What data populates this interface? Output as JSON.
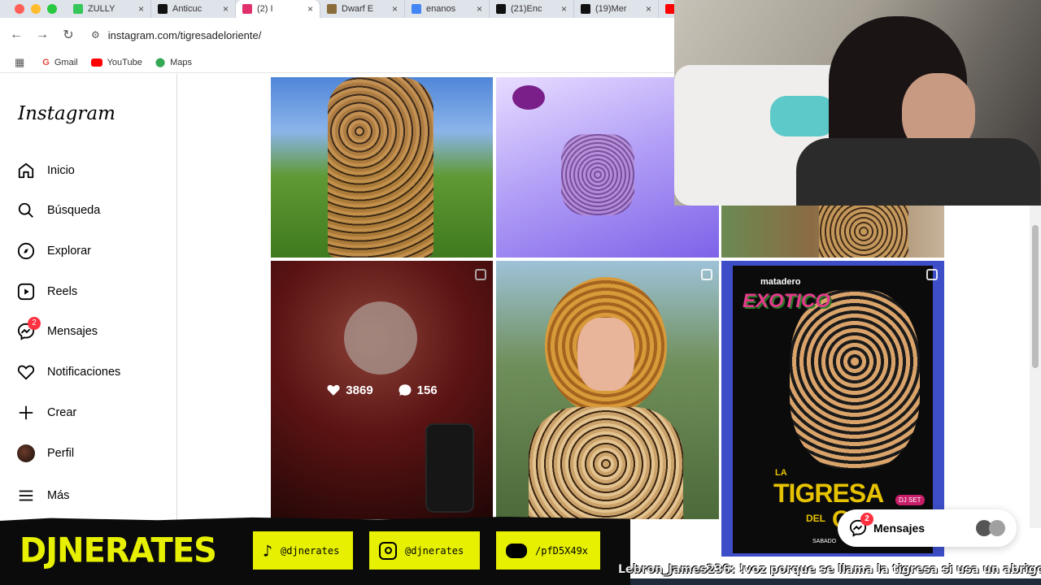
{
  "browser": {
    "tabs": [
      {
        "title": "ZULLY",
        "color": "#35c759",
        "active": false
      },
      {
        "title": "Anticuc",
        "color": "#111111",
        "active": false
      },
      {
        "title": "(2) I",
        "color": "#e1306c",
        "active": true
      },
      {
        "title": "Dwarf E",
        "color": "#8a6d3b",
        "active": false
      },
      {
        "title": "enanos",
        "color": "#4285f4",
        "active": false
      },
      {
        "title": "(21)Enc",
        "color": "#111111",
        "active": false
      },
      {
        "title": "(19)Mer",
        "color": "#111111",
        "active": false
      },
      {
        "title": "",
        "color": "#ff0000",
        "active": false
      }
    ],
    "url": "instagram.com/tigresadeloriente/",
    "bookmarks": [
      {
        "label": "Gmail",
        "icon": "gmail-icon",
        "color": "#ea4335"
      },
      {
        "label": "YouTube",
        "icon": "youtube-icon",
        "color": "#ff0000"
      },
      {
        "label": "Maps",
        "icon": "maps-icon",
        "color": "#34a853"
      }
    ]
  },
  "instagram": {
    "logo": "Instagram",
    "nav": [
      {
        "label": "Inicio",
        "icon": "home-icon"
      },
      {
        "label": "Búsqueda",
        "icon": "search-icon"
      },
      {
        "label": "Explorar",
        "icon": "compass-icon"
      },
      {
        "label": "Reels",
        "icon": "reels-icon"
      },
      {
        "label": "Mensajes",
        "icon": "messenger-icon",
        "badge": "2"
      },
      {
        "label": "Notificaciones",
        "icon": "heart-icon"
      },
      {
        "label": "Crear",
        "icon": "plus-icon"
      },
      {
        "label": "Perfil",
        "icon": "avatar-icon"
      },
      {
        "label": "Más",
        "icon": "menu-icon"
      }
    ],
    "hover_stats": {
      "likes": "3869",
      "comments": "156"
    },
    "poster": {
      "brand": "matadero",
      "title": "EXOTICO",
      "headline": "TIGRESA",
      "small": "DEL",
      "partial": "O",
      "tag": "DJ SET",
      "day": "SABADO",
      "prefix": "LA"
    },
    "messages_pill": {
      "label": "Mensajes",
      "badge": "2"
    }
  },
  "stream": {
    "brand": "DJNERATES",
    "socials": [
      {
        "handle": "@djnerates",
        "icon": "tiktok-icon"
      },
      {
        "handle": "@djnerates",
        "icon": "instagram-icon"
      },
      {
        "handle": "/pfD5X49x",
        "icon": "discord-icon"
      }
    ],
    "chat": {
      "user": "Lebron_James236",
      "message": ": !voz porque se llama la tigresa si usa un abrigo de lo"
    }
  },
  "colors": {
    "accent": "#e6f000",
    "badge": "#ff3040"
  }
}
